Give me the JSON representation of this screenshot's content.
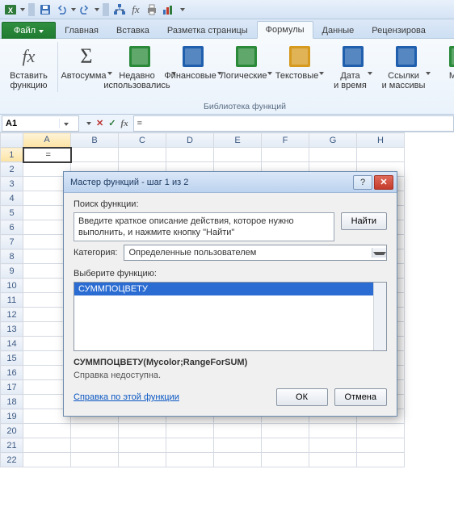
{
  "qat": {
    "icons": [
      "excel",
      "save",
      "undo",
      "redo",
      "sort",
      "insert-function",
      "print",
      "chart"
    ]
  },
  "tabs": {
    "file": "Файл",
    "items": [
      "Главная",
      "Вставка",
      "Разметка страницы",
      "Формулы",
      "Данные",
      "Рецензирова"
    ],
    "active_index": 3
  },
  "ribbon": {
    "group_label": "Библиотека функций",
    "buttons": [
      {
        "label": "Вставить функцию",
        "icon": "fx",
        "dd": false,
        "color": "#555"
      },
      {
        "label": "Автосумма",
        "icon": "sigma",
        "dd": true,
        "color": "#555"
      },
      {
        "label": "Недавно использовались",
        "icon": "book",
        "dd": true,
        "color": "#2a8a3a"
      },
      {
        "label": "Финансовые",
        "icon": "book",
        "dd": true,
        "color": "#1f5fad"
      },
      {
        "label": "Логические",
        "icon": "book",
        "dd": true,
        "color": "#2a8a3a"
      },
      {
        "label": "Текстовые",
        "icon": "book",
        "dd": true,
        "color": "#d69a1f"
      },
      {
        "label": "Дата и время",
        "icon": "book",
        "dd": true,
        "color": "#1f5fad"
      },
      {
        "label": "Ссылки и массивы",
        "icon": "book",
        "dd": true,
        "color": "#1f5fad"
      },
      {
        "label": "Мате",
        "icon": "book",
        "dd": false,
        "color": "#2a8a3a"
      }
    ]
  },
  "formula_bar": {
    "name": "A1",
    "formula": "="
  },
  "grid": {
    "columns": [
      "A",
      "B",
      "C",
      "D",
      "E",
      "F",
      "G",
      "H"
    ],
    "rows": 22,
    "active": {
      "row": 1,
      "col": "A",
      "value": "="
    }
  },
  "dialog": {
    "title": "Мастер функций - шаг 1 из 2",
    "search_label": "Поиск функции:",
    "search_text": "Введите краткое описание действия, которое нужно выполнить, и нажмите кнопку \"Найти\"",
    "find_btn": "Найти",
    "category_label": "Категория:",
    "category_value": "Определенные пользователем",
    "select_label": "Выберите функцию:",
    "list_selected": "СУММПОЦВЕТУ",
    "signature": "СУММПОЦВЕТУ(Mycolor;RangeForSUM)",
    "help_text": "Справка недоступна.",
    "help_link": "Справка по этой функции",
    "ok": "ОК",
    "cancel": "Отмена"
  }
}
